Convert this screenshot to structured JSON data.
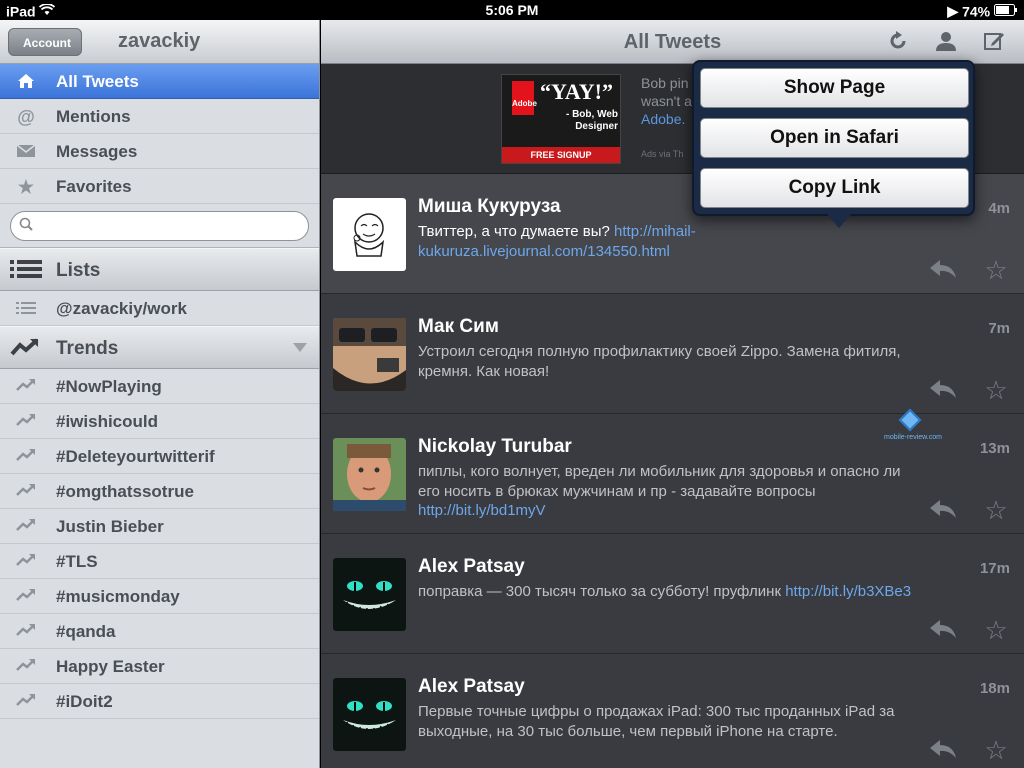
{
  "status": {
    "device": "iPad",
    "time": "5:06 PM",
    "battery": "74%"
  },
  "sidebar": {
    "account_button": "Account",
    "username": "zavackiy",
    "nav": [
      {
        "label": "All Tweets",
        "icon": "home-icon",
        "active": true
      },
      {
        "label": "Mentions",
        "icon": "at-icon"
      },
      {
        "label": "Messages",
        "icon": "envelope-icon"
      },
      {
        "label": "Favorites",
        "icon": "star-icon"
      }
    ],
    "search": {
      "placeholder": "",
      "value": ""
    },
    "lists_header": "Lists",
    "lists": [
      "@zavackiy/work"
    ],
    "trends_header": "Trends",
    "trends": [
      "#NowPlaying",
      "#iwishicould",
      "#Deleteyourtwitterif",
      "#omgthatssotrue",
      "Justin Bieber",
      "#TLS",
      "#musicmonday",
      "#qanda",
      "Happy Easter",
      "#iDoit2"
    ]
  },
  "main": {
    "title": "All Tweets",
    "ad": {
      "logo_text": "Adobe",
      "headline": "“YAY!”",
      "byline": "- Bob, Web Designer",
      "cta": "FREE SIGNUP",
      "text_line1": "Bob pin",
      "text_line2": "wasn't a",
      "text_link": "Adobe.",
      "via": "Ads via Th"
    },
    "tweets": [
      {
        "name": "Миша Кукуруза",
        "time": "4m",
        "text": "Твиттер, а что думаете вы? ",
        "url": "http://mihail-kukuruza.livejournal.com/134550.html",
        "selected": true
      },
      {
        "name": "Мак Сим",
        "time": "7m",
        "text": "Устроил сегодня полную профилактику своей Zippo. Замена фитиля, кремня. Как новая!",
        "url": ""
      },
      {
        "name": "Nickolay Turubar",
        "time": "13m",
        "text": "пиплы, кого волнует, вреден ли мобильник для здоровья и опасно ли его носить в брюках мужчинам и пр - задавайте вопросы ",
        "url": "http://bit.ly/bd1myV"
      },
      {
        "name": "Alex Patsay",
        "time": "17m",
        "text": "поправка — 300 тысяч только за субботу! пруфлинк ",
        "url": "http://bit.ly/b3XBe3"
      },
      {
        "name": "Alex Patsay",
        "time": "18m",
        "text": "Первые точные цифры о продажах iPad: 300 тыс проданных iPad за выходные, на 30 тыс больше, чем первый iPhone на старте.",
        "url": ""
      }
    ]
  },
  "popover": {
    "items": [
      "Show Page",
      "Open in Safari",
      "Copy Link"
    ]
  },
  "watermark": "mobile-review.com",
  "colors": {
    "accent": "#3b74d9",
    "link": "#6ea7ea",
    "ad_red": "#c8191c"
  }
}
